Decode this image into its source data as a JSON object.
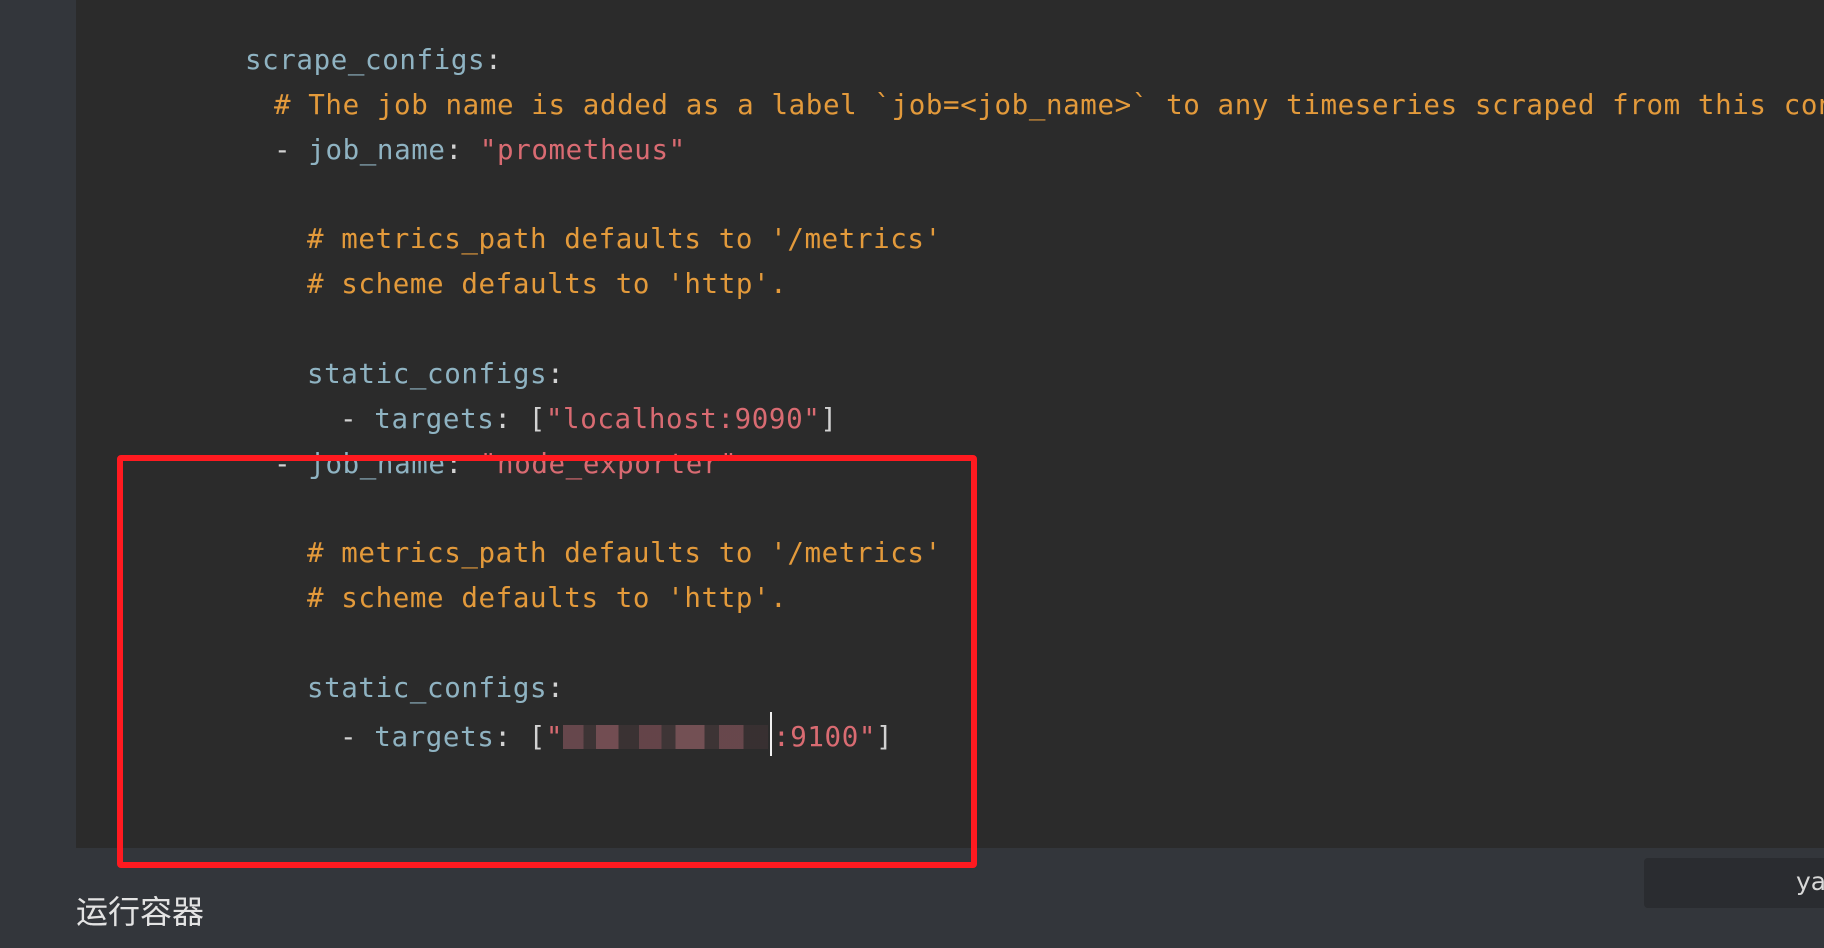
{
  "code": {
    "lines": [
      {
        "key": "scrape_configs",
        "colon": ":"
      },
      {
        "comment": "# The job name is added as a label `job=<job_name>` to any timeseries scraped from this config."
      },
      {
        "dash": "- ",
        "key": "job_name",
        "colon": ": ",
        "value": "\"prometheus\""
      },
      {
        "comment": "# metrics_path defaults to '/metrics'"
      },
      {
        "comment": "# scheme defaults to 'http'."
      },
      {
        "key": "static_configs",
        "colon": ":"
      },
      {
        "dash": "- ",
        "key": "targets",
        "colon": ": ",
        "open": "[",
        "value": "\"localhost:9090\"",
        "close": "]"
      },
      {
        "dash": "- ",
        "key": "job_name",
        "colon": ": ",
        "value": "\"node_exporter\""
      },
      {
        "comment": "# metrics_path defaults to '/metrics'"
      },
      {
        "comment": "# scheme defaults to 'http'."
      },
      {
        "key": "static_configs",
        "colon": ":"
      },
      {
        "dash": "- ",
        "key": "targets",
        "colon": ": ",
        "open": "[",
        "quote": "\"",
        "value_suffix": ":9100\"",
        "close": "]"
      }
    ]
  },
  "language_badge": {
    "label": "ya"
  },
  "section": {
    "title": "运行容器"
  },
  "colors": {
    "highlight_border": "#ff1a20",
    "comment": "#e39a3b",
    "key": "#8fb3c2",
    "string": "#d96b72"
  }
}
